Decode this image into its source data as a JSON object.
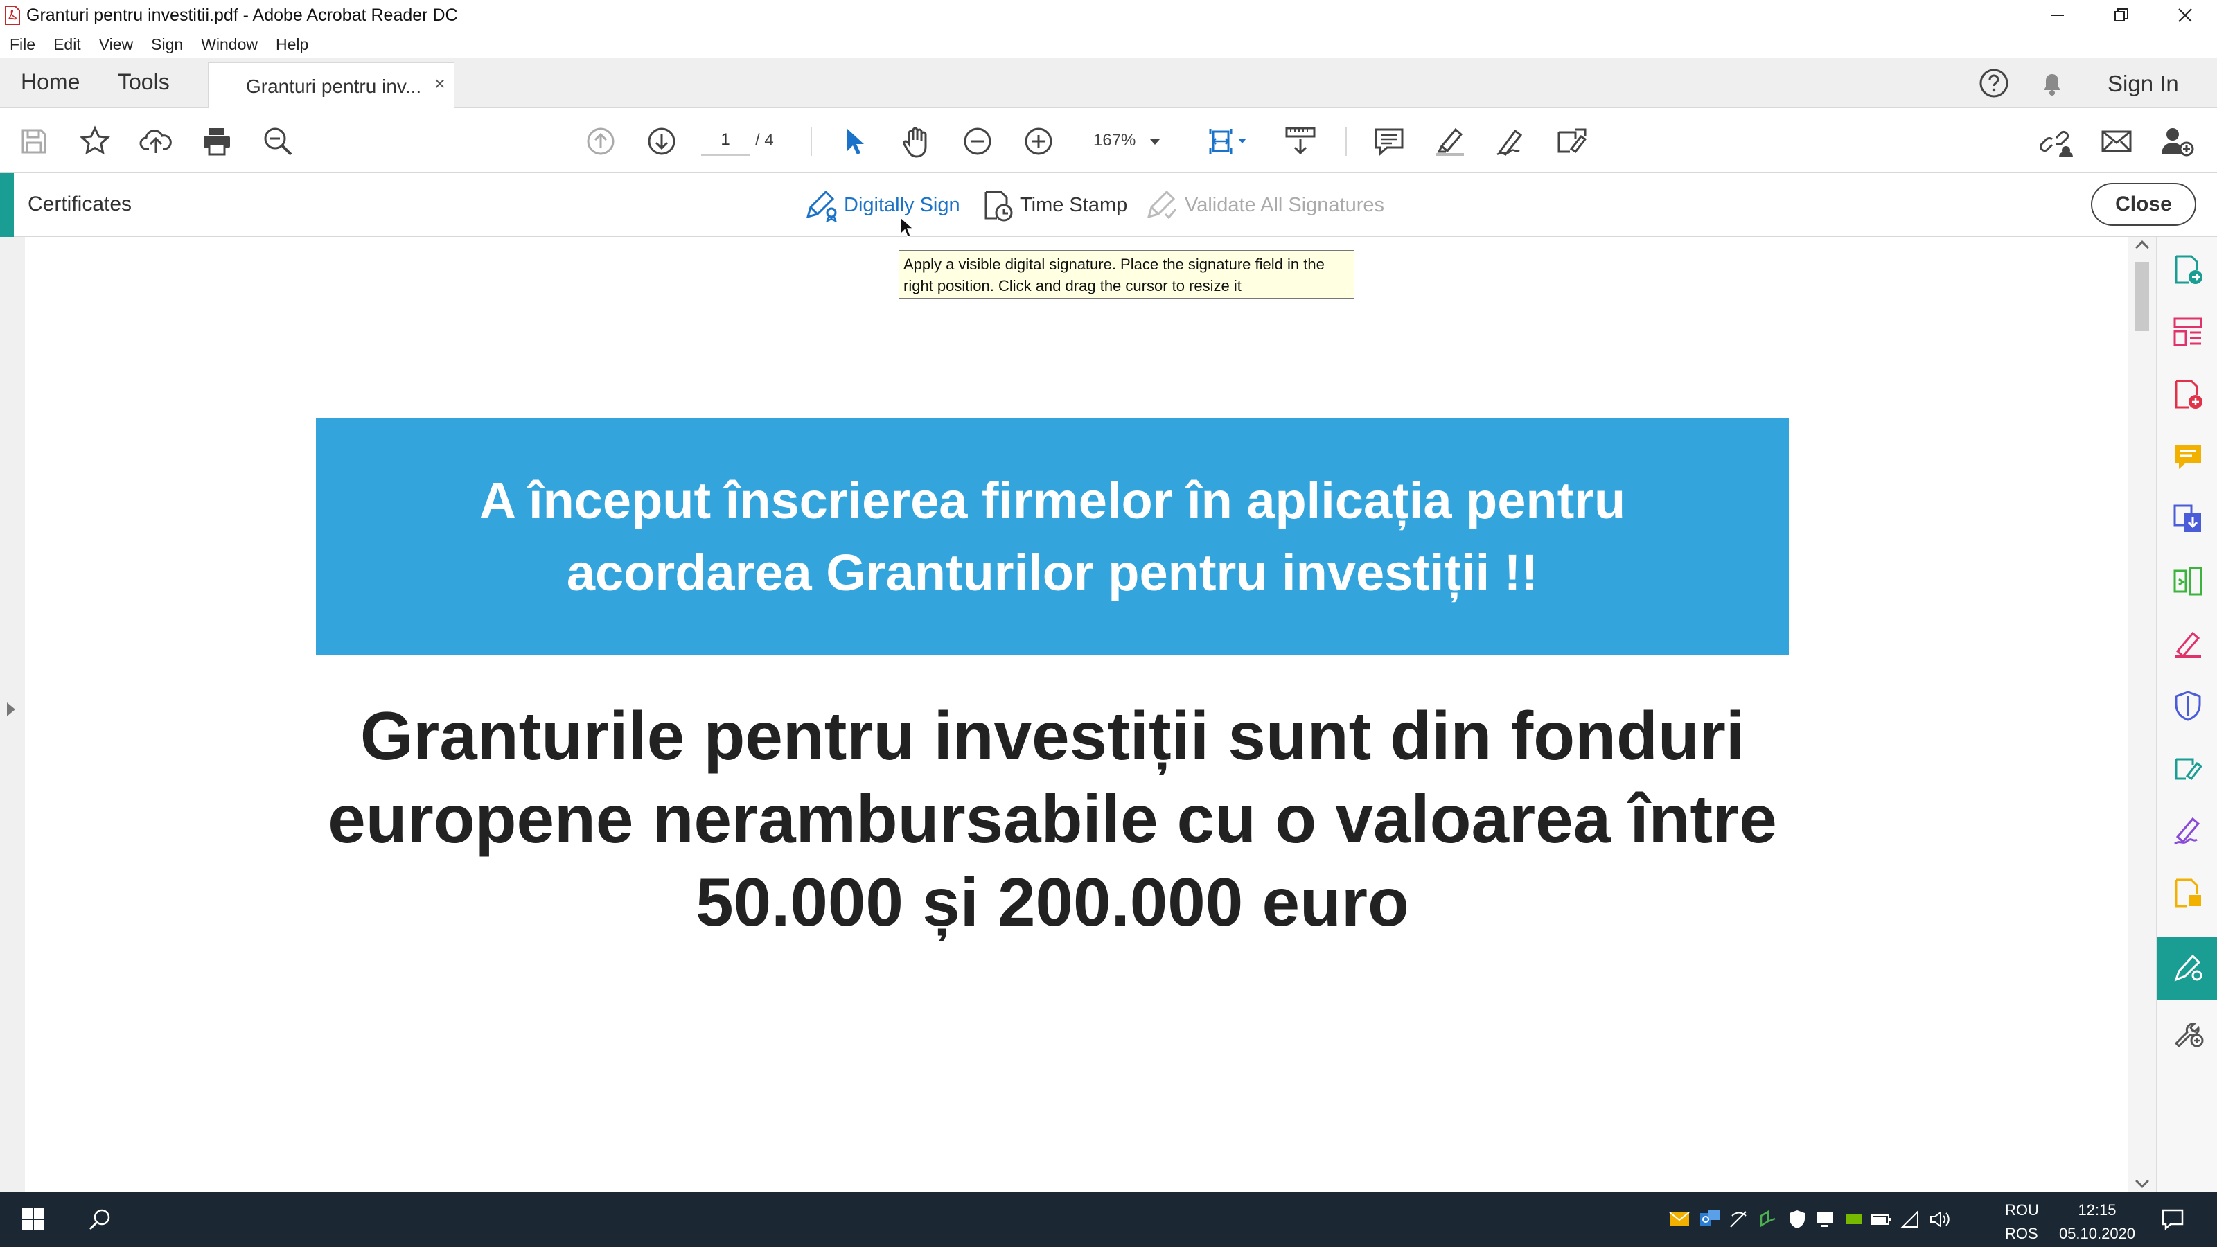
{
  "window": {
    "title": "Granturi pentru investitii.pdf - Adobe Acrobat Reader DC"
  },
  "menu": [
    "File",
    "Edit",
    "View",
    "Sign",
    "Window",
    "Help"
  ],
  "tabs": {
    "home": "Home",
    "tools": "Tools",
    "document": "Granturi pentru inv...",
    "close_glyph": "×",
    "sign_in": "Sign In"
  },
  "toolbar": {
    "page_current": "1",
    "page_total": "/  4",
    "zoom": "167%"
  },
  "certificates": {
    "title": "Certificates",
    "digitally_sign": "Digitally Sign",
    "time_stamp": "Time Stamp",
    "validate_all": "Validate All Signatures",
    "close": "Close"
  },
  "tooltip": "Apply a visible digital signature. Place the signature field in the right position. Click and drag the cursor to resize it",
  "document": {
    "banner": "A început înscrierea firmelor în aplicația pentru acordarea Granturilor pentru investiții !!",
    "heading": "Granturile pentru investiții sunt din fonduri europene nerambursabile cu o valoarea între 50.000 și 200.000 euro"
  },
  "taskbar": {
    "lang_top": "ROU",
    "lang_bottom": "ROS",
    "time": "12:15",
    "date": "05.10.2020"
  },
  "colors": {
    "accent": "#1a9d93",
    "banner": "#33a5dc",
    "link_blue": "#1a73c8",
    "taskbar": "#1b2732"
  }
}
